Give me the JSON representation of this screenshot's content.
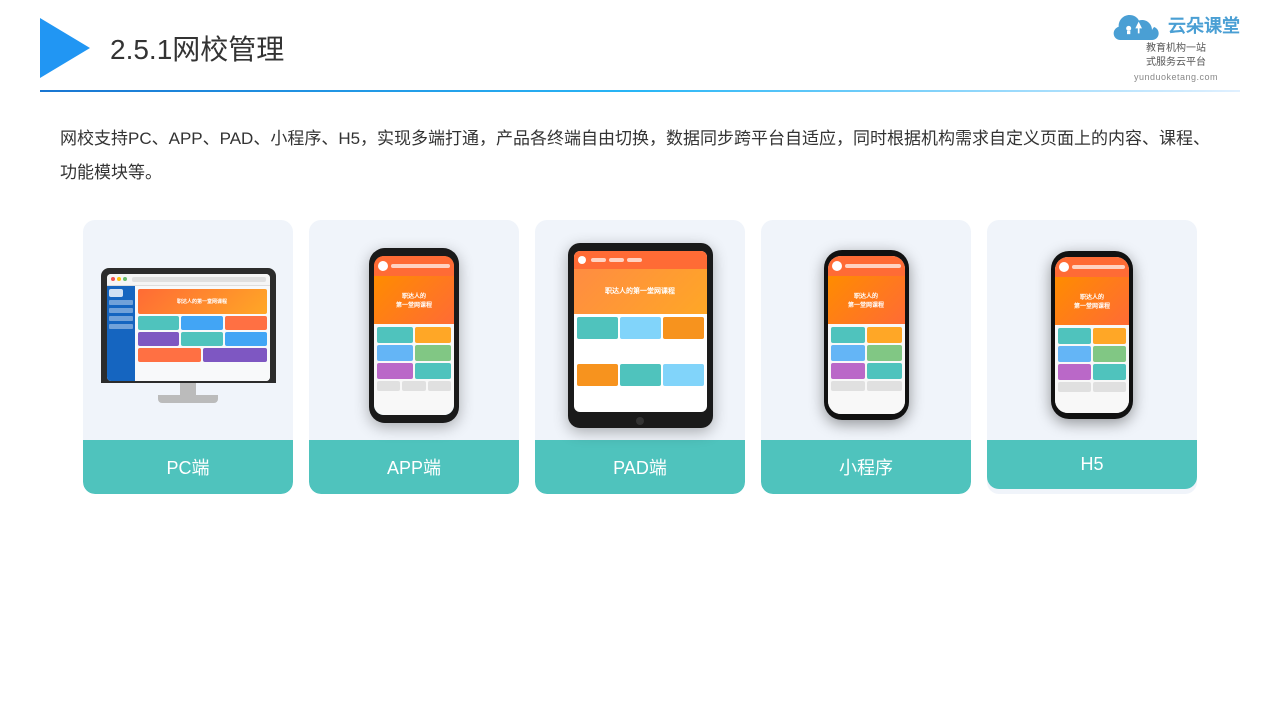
{
  "header": {
    "title": "2.5.1网校管理",
    "title_number": "2.5.1",
    "title_text": "网校管理"
  },
  "brand": {
    "name_cn": "云朵课堂",
    "name_en": "yunduoketang.com",
    "tagline_line1": "教育机构一站",
    "tagline_line2": "式服务云平台"
  },
  "description": {
    "text": "网校支持PC、APP、PAD、小程序、H5，实现多端打通，产品各终端自由切换，数据同步跨平台自适应，同时根据机构需求自定义页面上的内容、课程、功能模块等。"
  },
  "cards": [
    {
      "label": "PC端",
      "device": "pc"
    },
    {
      "label": "APP端",
      "device": "app"
    },
    {
      "label": "PAD端",
      "device": "pad"
    },
    {
      "label": "小程序",
      "device": "wechat"
    },
    {
      "label": "H5",
      "device": "h5"
    }
  ],
  "teal_color": "#4fc3bd",
  "divider_left_color": "#1565c0",
  "divider_right_color": "#bbdefb"
}
